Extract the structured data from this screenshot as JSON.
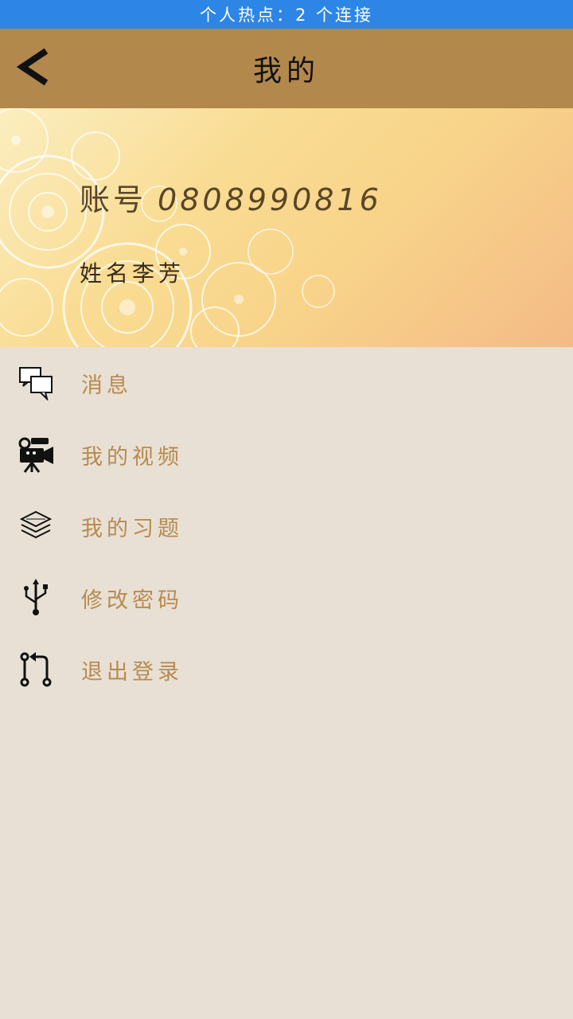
{
  "status_bar": {
    "text": "个人热点：2 个连接"
  },
  "app_bar": {
    "title": "我的",
    "back_icon": "chevron-left-icon"
  },
  "profile": {
    "account_label": "账号",
    "account_number": "0808990816",
    "name_label": "姓名",
    "name_value": "李芳"
  },
  "menu": {
    "items": [
      {
        "label": "消息",
        "icon": "chat-bubbles-icon"
      },
      {
        "label": "我的视频",
        "icon": "video-camera-icon"
      },
      {
        "label": "我的习题",
        "icon": "layers-icon"
      },
      {
        "label": "修改密码",
        "icon": "usb-icon"
      },
      {
        "label": "退出登录",
        "icon": "logout-arrow-icon"
      }
    ]
  },
  "colors": {
    "status_bar": "#2d86e6",
    "app_bar": "#b3884d",
    "page_background": "#e8e0d4",
    "menu_text": "#b88a50"
  }
}
